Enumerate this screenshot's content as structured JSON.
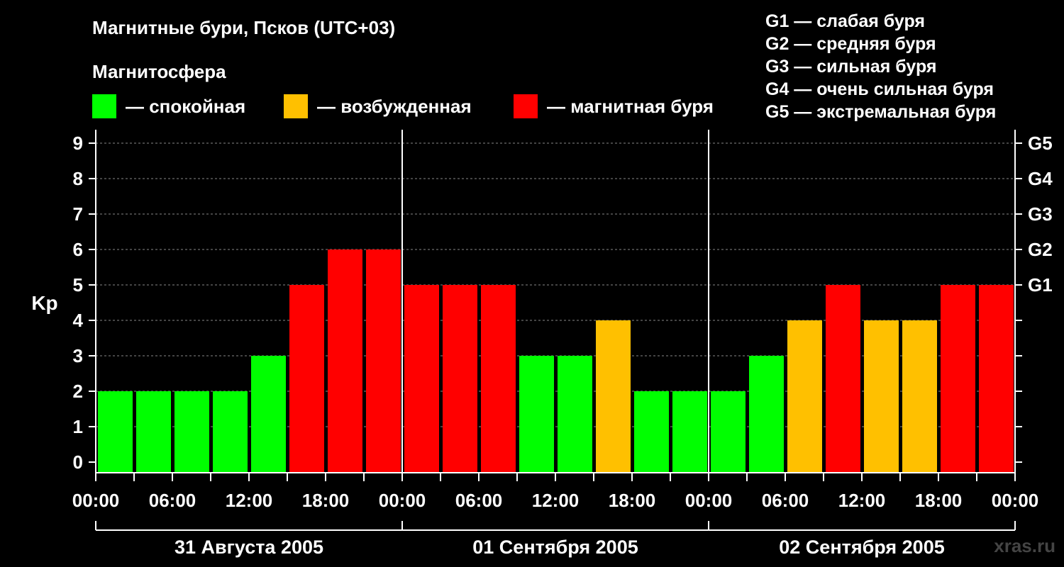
{
  "title": "Магнитные бури, Псков (UTC+03)",
  "subtitle": "Магнитосфера",
  "legend": [
    {
      "label": "— спокойная",
      "color": "#00ff00"
    },
    {
      "label": "— возбужденная",
      "color": "#ffc000"
    },
    {
      "label": "— магнитная буря",
      "color": "#ff0000"
    }
  ],
  "g_scale": [
    "G1 — слабая буря",
    "G2 — средняя буря",
    "G3 — сильная буря",
    "G4 — очень сильная буря",
    "G5 — экстремальная буря"
  ],
  "watermark": "xras.ru",
  "colors": {
    "quiet": "#00ff00",
    "excited": "#ffc000",
    "storm": "#ff0000",
    "background": "#000000",
    "axis": "#ffffff",
    "grid": "#888888"
  },
  "chart_data": {
    "type": "bar",
    "ylabel": "Kp",
    "ylim": [
      0,
      9
    ],
    "yticks": [
      "0",
      "1",
      "2",
      "3",
      "4",
      "5",
      "6",
      "7",
      "8",
      "9"
    ],
    "right_axis_ticks": [
      {
        "kp": 5,
        "label": "G1"
      },
      {
        "kp": 6,
        "label": "G2"
      },
      {
        "kp": 7,
        "label": "G3"
      },
      {
        "kp": 8,
        "label": "G4"
      },
      {
        "kp": 9,
        "label": "G5"
      }
    ],
    "grid": true,
    "xtick_labels": [
      "00:00",
      "06:00",
      "12:00",
      "18:00",
      "00:00",
      "06:00",
      "12:00",
      "18:00",
      "00:00",
      "06:00",
      "12:00",
      "18:00",
      "00:00"
    ],
    "days": [
      "31 Августа 2005",
      "01 Сентября 2005",
      "02 Сентября 2005"
    ],
    "values": [
      2,
      2,
      2,
      2,
      3,
      5,
      6,
      6,
      5,
      5,
      5,
      3,
      3,
      4,
      2,
      2,
      2,
      3,
      4,
      5,
      4,
      4,
      5,
      5
    ],
    "categories": [
      "quiet",
      "quiet",
      "quiet",
      "quiet",
      "quiet",
      "storm",
      "storm",
      "storm",
      "storm",
      "storm",
      "storm",
      "quiet",
      "quiet",
      "excited",
      "quiet",
      "quiet",
      "quiet",
      "quiet",
      "excited",
      "storm",
      "excited",
      "excited",
      "storm",
      "storm"
    ]
  }
}
